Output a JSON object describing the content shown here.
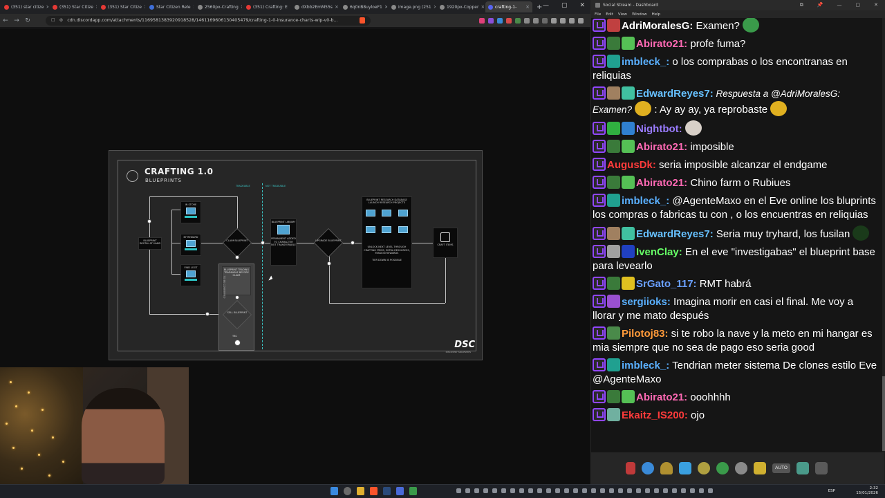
{
  "browser": {
    "tabs": [
      {
        "label": "(351) star citize",
        "color": "#e53935"
      },
      {
        "label": "(351) Star Citize",
        "color": "#e53935"
      },
      {
        "label": "(351) Star Citize",
        "color": "#e53935"
      },
      {
        "label": "Star Citizen Rele",
        "color": "#3f6fd8"
      },
      {
        "label": "2560px-Crafting",
        "color": "#8a8a8a"
      },
      {
        "label": "(351) Crafting: E",
        "color": "#e53935"
      },
      {
        "label": "dXbb2EmM55s",
        "color": "#8a8a8a"
      },
      {
        "label": "6q0nB8uyloeF1",
        "color": "#8a8a8a"
      },
      {
        "label": "image.png (251",
        "color": "#8a8a8a"
      },
      {
        "label": "1920px-Copper",
        "color": "#8a8a8a"
      },
      {
        "label": "crafting-1-",
        "color": "#5865f2",
        "active": true
      }
    ],
    "new_tab": "+",
    "url": "cdn.discordapp.com/attachments/1169581383920918528/1461169606130405479/crafting-1-0-insurance-charts-wip-v0-b...",
    "window_controls": [
      "—",
      "▢",
      "✕"
    ]
  },
  "poster": {
    "title": "CRAFTING 1.0",
    "subtitle": "BLUEPRINTS",
    "tag_left": "TRADEABLE",
    "tag_right": "NOT TRADEABLE",
    "nodes": {
      "digital": "BLUEPRINT DIGITAL AT HAND",
      "in_store": "IN STORE",
      "by_reward": "BY REWARD",
      "find_loot": "FIND LOOT",
      "claim": "CLAIM BLUEPRINT",
      "library": "BLUEPRINT LIBRARY",
      "library_note": "PERMANENT ADDED TO CHARACTER",
      "library_note2": "NOT TRANSFERABLE",
      "upgrade": "UPGRADE BLUEPRINT",
      "research": "BLUEPRINT RESEARCH DATABASE",
      "research_sub": "LAUNCH RESEARCH PROJECTS",
      "research_note": "UNLOCK NEXT LEVEL THROUGH CRAFTING ITEMS, EXTRA RESOURCES, MISSION REWARDS",
      "research_note2": "TIER DOWN IS POSSIBLE",
      "craft": "CRAFT ITEMS",
      "trading": "BLUEPRINT TRADING",
      "trading_sub": "TRADEABLE BEFORE CLAIM",
      "sell": "SELL BLUEPRINT",
      "confirmed": "TO BE CONFIRMED",
      "tbc": "TBC"
    },
    "brand": "DSC",
    "brand_sub": "DISCOVERY SPACESHIPS"
  },
  "chat": {
    "title": "Social Stream - Dashboard",
    "menu": [
      "File",
      "Edit",
      "View",
      "Window",
      "Help"
    ],
    "window_controls": [
      "⧉",
      "📌",
      "—",
      "▢",
      "✕"
    ],
    "messages": [
      {
        "user": "AdriMoralesG:",
        "color": "#ffffff",
        "text": " Examen?",
        "badges": [
          "tw",
          "#c04040"
        ],
        "emote": "#3a9a4a"
      },
      {
        "user": "Abirato21:",
        "color": "#ff69b4",
        "text": " profe fuma?",
        "badges": [
          "tw",
          "#3a7a3a",
          "#55c055"
        ]
      },
      {
        "user": "imbleck_:",
        "color": "#5ab0ff",
        "text": " o los comprabas o los encontranas en reliquias",
        "badges": [
          "tw",
          "#20a090"
        ]
      },
      {
        "user": "EdwardReyes7:",
        "color": "#66c0ff",
        "reply": " Respuesta a @AdriMoralesG: Examen?",
        "text": "      :  Ay ay ay, ya reprobaste",
        "badges": [
          "tw",
          "#a08060",
          "#40c0a0"
        ],
        "emote": "#e0b020"
      },
      {
        "user": "Nightbot:",
        "color": "#9a7cff",
        "text": "",
        "badges": [
          "tw",
          "#30b040",
          "#3080d0"
        ],
        "emote": "#d8d0c8"
      },
      {
        "user": "Abirato21:",
        "color": "#ff69b4",
        "text": " imposible",
        "badges": [
          "tw",
          "#3a7a3a",
          "#55c055"
        ]
      },
      {
        "user": "AugusDk:",
        "color": "#ff3b3b",
        "text": " seria imposible alcanzar el endgame",
        "badges": [
          "tw"
        ]
      },
      {
        "user": "Abirato21:",
        "color": "#ff69b4",
        "text": " Chino farm o Rubiues",
        "badges": [
          "tw",
          "#3a7a3a",
          "#55c055"
        ]
      },
      {
        "user": "imbleck_:",
        "color": "#5ab0ff",
        "text": " @AgenteMaxo en el Eve online los bluprints los compras o fabricas tu con , o los encuentras en reliquias",
        "badges": [
          "tw",
          "#20a090"
        ]
      },
      {
        "user": "EdwardReyes7:",
        "color": "#66c0ff",
        "text": " Seria muy tryhard, los fusilan",
        "badges": [
          "tw",
          "#a08060",
          "#40c0a0"
        ],
        "emote": "#1a3a1a"
      },
      {
        "user": "IvenClay:",
        "color": "#66ff66",
        "text": " En el eve \"investigabas\" el blueprint base para levearlo",
        "badges": [
          "tw",
          "#a0a0a0",
          "#2040c0"
        ]
      },
      {
        "user": "SrGato_117:",
        "color": "#6aa0ff",
        "text": " RMT habrá",
        "badges": [
          "tw",
          "#3a7a3a",
          "#e0c020"
        ]
      },
      {
        "user": "sergiioks:",
        "color": "#5ab0ff",
        "text": " Imagina morir en casi el final. Me voy a llorar y me mato después",
        "badges": [
          "tw",
          "#9a50d0"
        ]
      },
      {
        "user": "Pilotoj83:",
        "color": "#ff9a3a",
        "text": " si te robo la nave y la meto en mi hangar es mia siempre que no sea de pago eso seria good",
        "badges": [
          "tw",
          "#4a8a4a"
        ]
      },
      {
        "user": "imbleck_:",
        "color": "#5ab0ff",
        "text": " Tendrian meter sistema De clones estilo Eve @AgenteMaxo",
        "badges": [
          "tw",
          "#20a090"
        ]
      },
      {
        "user": "Abirato21:",
        "color": "#ff69b4",
        "text": " ooohhhh",
        "badges": [
          "tw",
          "#3a7a3a",
          "#55c055"
        ]
      },
      {
        "user": "Ekaitz_IS200:",
        "color": "#ff3b3b",
        "text": " ojo",
        "badges": [
          "tw",
          "#70b0a0"
        ]
      }
    ],
    "toolbar": {
      "auto_label": "AUTO"
    }
  },
  "taskbar": {
    "lang": "ESP",
    "time": "2:32",
    "date": "15/01/2026"
  }
}
